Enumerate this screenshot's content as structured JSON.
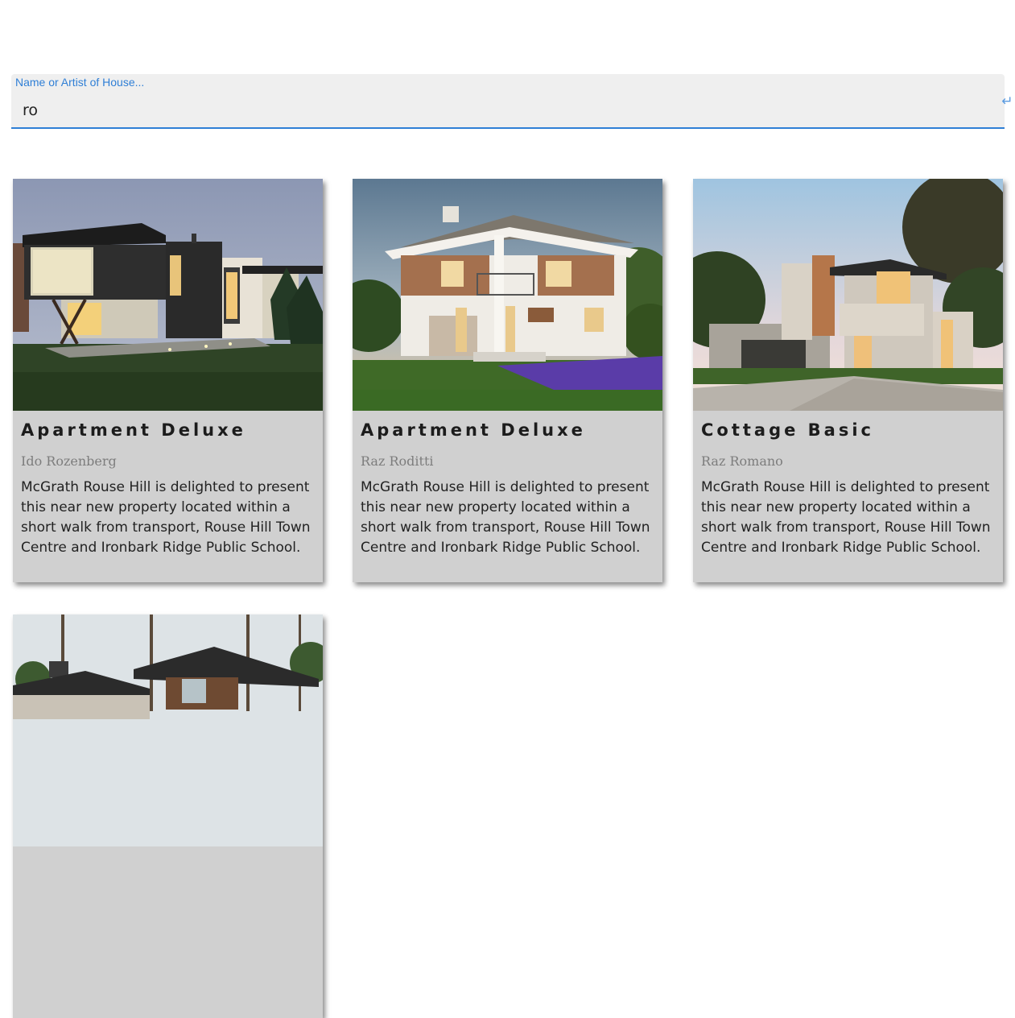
{
  "search": {
    "label": "Name or Artist of House...",
    "value": "ro",
    "submit_icon": "enter-icon"
  },
  "cards": [
    {
      "title": "Apartment Deluxe",
      "artist": "Ido Rozenberg",
      "description": "McGrath Rouse Hill is delighted to present this near new property located within a short walk from transport, Rouse Hill Town Centre and Ironbark Ridge Public School."
    },
    {
      "title": "Apartment Deluxe",
      "artist": "Raz Roditti",
      "description": "McGrath Rouse Hill is delighted to present this near new property located within a short walk from transport, Rouse Hill Town Centre and Ironbark Ridge Public School."
    },
    {
      "title": "Cottage Basic",
      "artist": "Raz Romano",
      "description": "McGrath Rouse Hill is delighted to present this near new property located within a short walk from transport, Rouse Hill Town Centre and Ironbark Ridge Public School."
    }
  ],
  "colors": {
    "accent": "#2f7fd6",
    "card_bg": "#d0d0d0"
  }
}
